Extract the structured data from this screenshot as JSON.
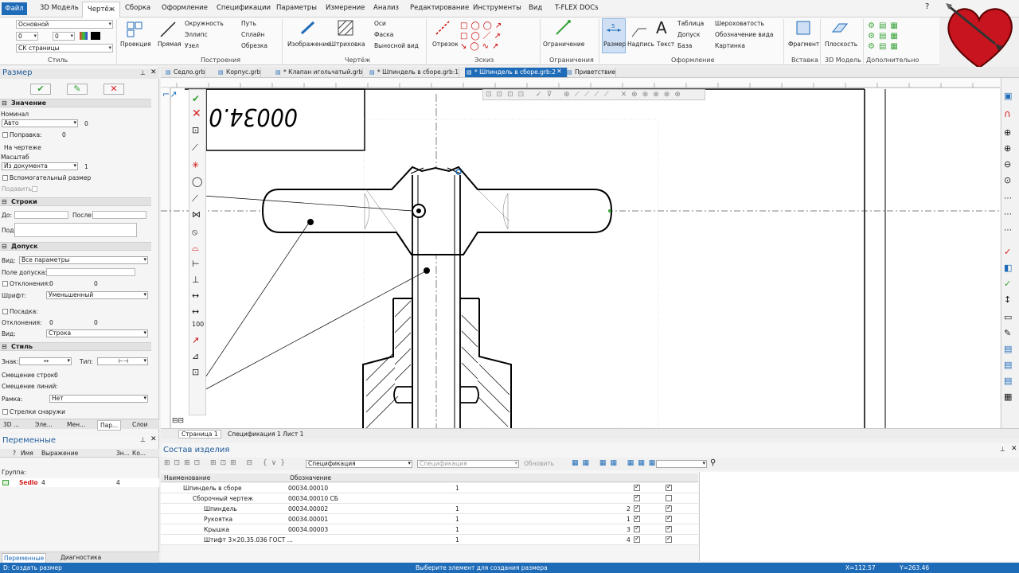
{
  "menu": {
    "file": "Файл",
    "items": [
      "3D Модель",
      "Чертёж",
      "Сборка",
      "Оформление",
      "Спецификации",
      "Параметры",
      "Измерение",
      "Анализ",
      "Редактирование",
      "Инструменты",
      "Вид",
      "T-FLEX DOCs"
    ]
  },
  "ribbon": {
    "style_combo": "Основной",
    "num1": "0",
    "num2": "0",
    "cs_combo": "СК страницы",
    "projection": "Проекция",
    "line": "Прямая",
    "circle": "Окружность",
    "ellipse": "Эллипс",
    "node": "Узел",
    "path": "Путь",
    "spline": "Сплайн",
    "trim": "Обрезка",
    "image": "Изображение",
    "hatch": "Штриховка",
    "axes": "Оси",
    "chamfer": "Фаска",
    "detail_view": "Выносной вид",
    "segment": "Отрезок",
    "constraints": "Ограничение",
    "dimension": "Размер",
    "label": "Надпись",
    "text": "Текст",
    "table": "Таблица",
    "tolerance": "Допуск",
    "base": "База",
    "roughness": "Шероховатость",
    "view_label": "Обозначение вида",
    "picture": "Картинка",
    "fragment": "Фрагмент",
    "plane": "Плоскость",
    "groups": [
      "Стиль",
      "Построения",
      "Чертёж",
      "Эскиз",
      "Ограничения",
      "Оформление",
      "Вставка",
      "3D Модель",
      "Дополнительно"
    ]
  },
  "left_panel": {
    "title": "Размер",
    "sec_value": "Значение",
    "nominal": "Номинал",
    "nominal_mode": "Авто",
    "nominal_val": "0",
    "correction_lbl": "Поправка:",
    "correction_val": "0",
    "on_drawing": "На чертеже",
    "scale_lbl": "Масштаб",
    "scale_mode": "Из документа",
    "scale_val": "1",
    "aux_dim": "Вспомогательный размер",
    "suppress": "Подавить",
    "sec_rows": "Строки",
    "before": "До:",
    "after": "После:",
    "under": "Под:",
    "sec_tol": "Допуск",
    "view_lbl": "Вид:",
    "view_val": "Все параметры",
    "tol_field": "Поле допуска:",
    "deviations": "Отклонения:",
    "dev1": "0",
    "dev2": "0",
    "font_lbl": "Шрифт:",
    "font_val": "Уменьшенный",
    "fit_lbl": "Посадка:",
    "dev3": "0",
    "dev4": "0",
    "view2_val": "Строка",
    "sec_style": "Стиль",
    "sign": "Знак:",
    "type": "Тип:",
    "row_offset": "Смещение строк:",
    "row_offset_val": "0",
    "line_offset": "Смещение линий:",
    "frame_lbl": "Рамка:",
    "frame_val": "Нет",
    "outer_arrows": "Стрелки снаружи",
    "bottom_tabs": [
      "3D ...",
      "Эле...",
      "Мен...",
      "Пар...",
      "Слои"
    ]
  },
  "doc_tabs": [
    "Седло.grb",
    "Корпус.grb",
    "* Клапан игольчатый.grb",
    "* Шпиндель в сборе.grb:1",
    "* Шпиндель в сборе.grb:2",
    "Приветствие"
  ],
  "drawing": {
    "title_text": "00034.0"
  },
  "page_tabs": [
    "Страница 1",
    "Спецификация 1 Лист 1"
  ],
  "variables": {
    "title": "Переменные",
    "col_name": "Имя",
    "col_expr": "Выражение",
    "col_val": "Зн...",
    "col_comment": "Ко...",
    "group": "Группа:",
    "var_name": "Sedlo",
    "var_expr": "4",
    "var_val": "4",
    "bottom_tabs": [
      "Переменные",
      "Диагностика"
    ]
  },
  "bom": {
    "title": "Состав изделия",
    "combo1": "Спецификация",
    "combo2": "Спецификация",
    "refresh": "Обновить",
    "col_name": "Наименование",
    "col_designation": "Обозначение",
    "rows": [
      {
        "name": "Шпиндель в сборе",
        "designation": "00034.00010",
        "qty": "1",
        "pos": ""
      },
      {
        "name": "Сборочный чертеж",
        "designation": "00034.00010 СБ",
        "qty": "",
        "pos": ""
      },
      {
        "name": "Шпиндель",
        "designation": "00034.00002",
        "qty": "1",
        "pos": "2"
      },
      {
        "name": "Рукоятка",
        "designation": "00034.00001",
        "qty": "1",
        "pos": "1"
      },
      {
        "name": "Крышка",
        "designation": "00034.00003",
        "qty": "1",
        "pos": "3"
      },
      {
        "name": "Штифт 3×20.35.036 ГОСТ ...",
        "designation": "",
        "qty": "1",
        "pos": "4"
      }
    ]
  },
  "status": {
    "left": "D: Создать размер",
    "center": "Выберите элемент для создания размера",
    "x": "X=112.57",
    "y": "Y=263.46"
  },
  "colors": {
    "accent": "#1e6bb8",
    "cancel": "#d42020",
    "ok": "#3aa33a"
  }
}
